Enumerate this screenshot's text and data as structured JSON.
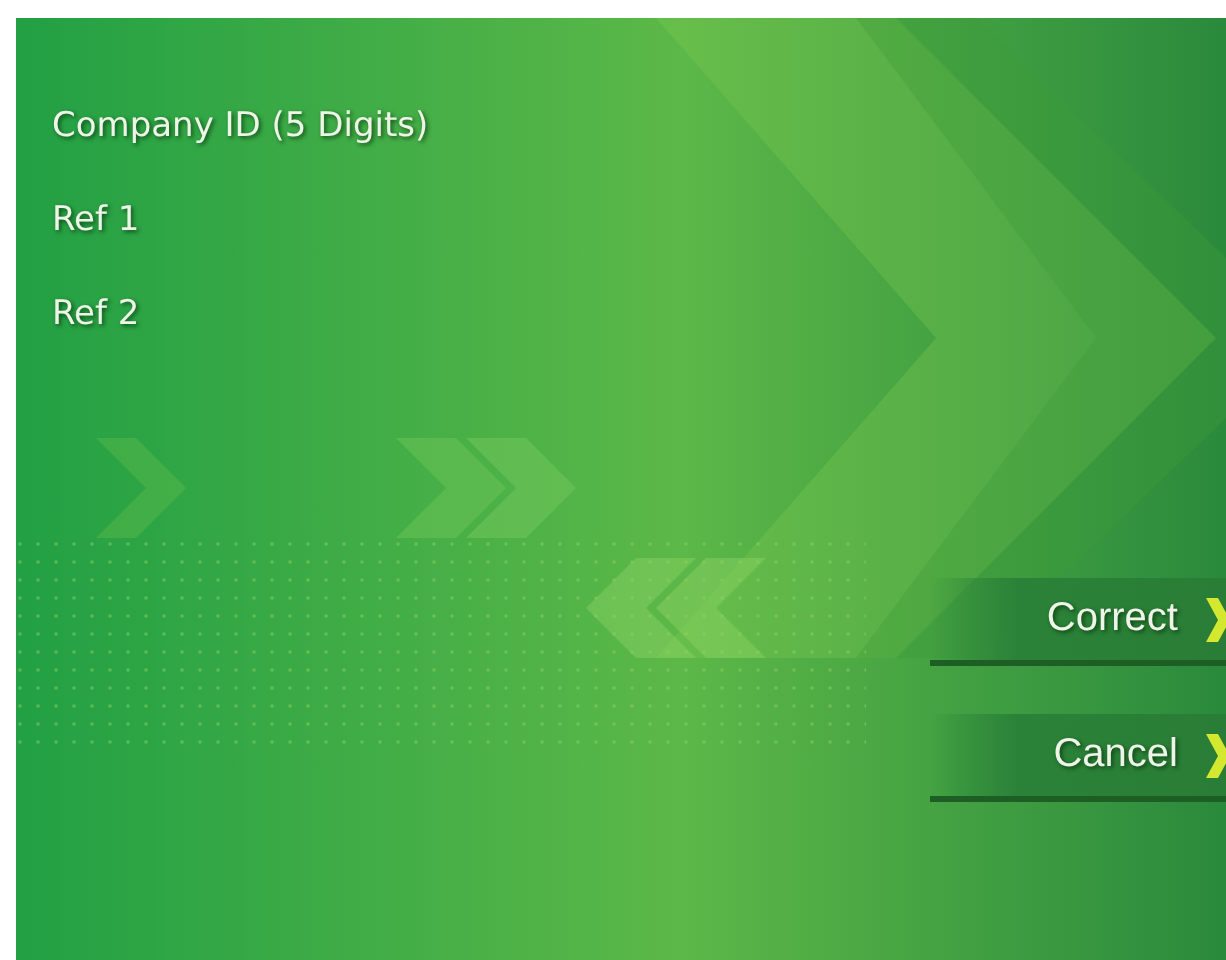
{
  "fields": [
    {
      "label": "Company ID (5 Digits)"
    },
    {
      "label": "Ref 1"
    },
    {
      "label": "Ref 2"
    }
  ],
  "buttons": [
    {
      "label": "Correct"
    },
    {
      "label": "Cancel"
    }
  ]
}
